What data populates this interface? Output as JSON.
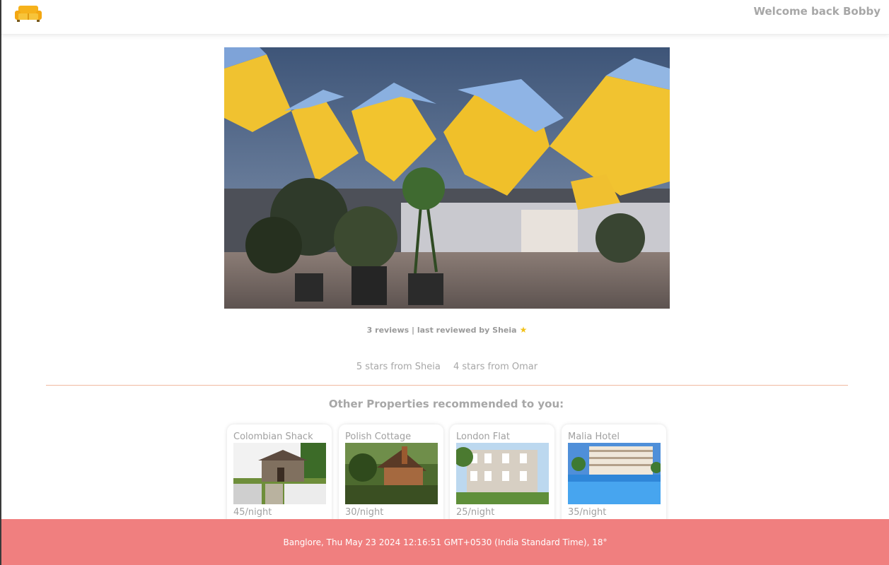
{
  "header": {
    "logo_icon": "sofa-icon",
    "welcome_text": "Welcome back Bobby"
  },
  "property": {
    "hero_image": "cube-houses-photo",
    "reviews_summary": "3 reviews | last reviewed by Sheia",
    "star_icon": "star-icon",
    "star_color": "#f2c21b",
    "reviews": [
      {
        "text": "5 stars from Sheia",
        "stars": 5
      },
      {
        "text": "4 stars from Omar",
        "stars": 4
      }
    ]
  },
  "recommendations": {
    "title": "Other Properties recommended to you:",
    "items": [
      {
        "name": "Colombian Shack",
        "price": "45/night",
        "image": "wooden-shack-photo"
      },
      {
        "name": "Polish Cottage",
        "price": "30/night",
        "image": "brick-cottage-photo"
      },
      {
        "name": "London Flat",
        "price": "25/night",
        "image": "townhouse-photo"
      },
      {
        "name": "Malia Hotel",
        "price": "35/night",
        "image": "hotel-pool-photo"
      }
    ]
  },
  "footer": {
    "text": "Banglore, Thu May 23 2024 12:16:51 GMT+0530 (India Standard Time), 18°",
    "background": "#f07f7f"
  }
}
